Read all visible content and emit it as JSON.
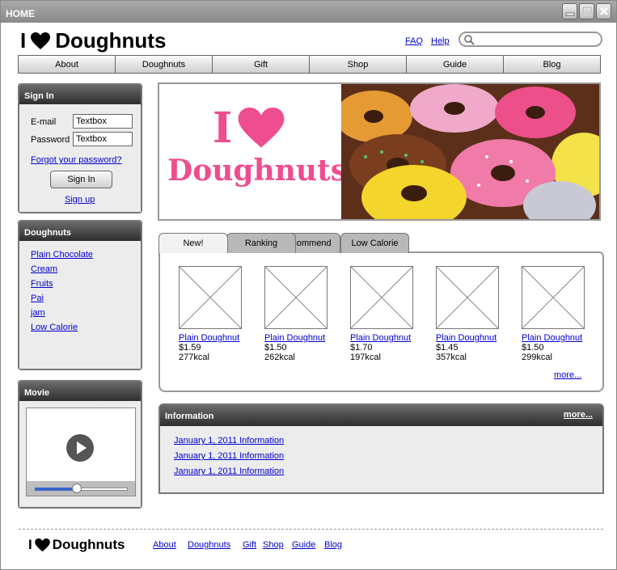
{
  "window": {
    "title": "HOME"
  },
  "header": {
    "brand_prefix": "I",
    "brand_name": "Doughnuts",
    "faq": "FAQ",
    "help": "Help",
    "search_placeholder": ""
  },
  "nav": [
    "About",
    "Doughnuts",
    "Gift",
    "Shop",
    "Guide",
    "Blog"
  ],
  "signin": {
    "title": "Sign In",
    "email_label": "E-mail",
    "email_value": "Textbox",
    "password_label": "Password",
    "password_value": "Textbox",
    "forgot": "Forgot your password?",
    "button": "Sign In",
    "signup": "Sign up"
  },
  "doughnuts_panel": {
    "title": "Doughnuts",
    "items": [
      "Plain Chocolate",
      "Cream",
      "Fruits",
      "Pai",
      "jam",
      "Low Calorie"
    ]
  },
  "movie": {
    "title": "Movie",
    "progress": 0.45
  },
  "banner": {
    "line1": "I",
    "line2": "Doughnuts"
  },
  "tabs": [
    "New!",
    "Ranking",
    "Recommend",
    "Low Calorie"
  ],
  "products": [
    {
      "name": "Plain Doughnut",
      "price": "$1.59",
      "kcal": "277kcal"
    },
    {
      "name": "Plain Doughnut",
      "price": "$1.50",
      "kcal": "262kcal"
    },
    {
      "name": "Plain Doughnut",
      "price": "$1.70",
      "kcal": "197kcal"
    },
    {
      "name": "Plain Doughnut",
      "price": "$1.45",
      "kcal": "357kcal"
    },
    {
      "name": "Plain Doughnut",
      "price": "$1.50",
      "kcal": "299kcal"
    }
  ],
  "products_more": "more...",
  "information": {
    "title": "Information",
    "more": "more...",
    "items": [
      "January 1, 2011  Information",
      "January 1, 2011  Information",
      "January 1, 2011  Information"
    ]
  },
  "footer": {
    "brand_prefix": "I",
    "brand_name": "Doughnuts",
    "links": [
      "About",
      "Doughnuts",
      "Gift",
      "Shop",
      "Guide",
      "Blog"
    ]
  },
  "colors": {
    "heart": "#ee4d8f",
    "link": "#0000cc",
    "panel_head": "#3c3c3c",
    "title_bar": "#999999",
    "slider": "#3a66cc"
  }
}
